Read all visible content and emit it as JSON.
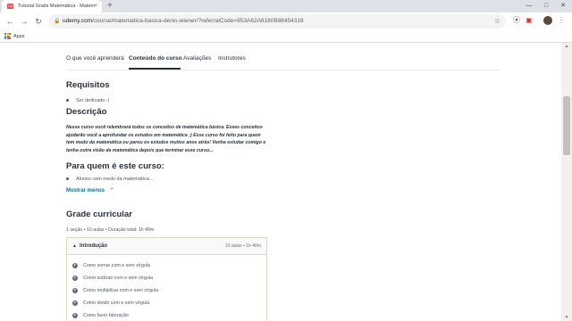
{
  "browser": {
    "tab_title": "Tutorial Gratis Matemática - Matem",
    "favicon_label": "Ud",
    "tab_close": "×",
    "new_tab": "+",
    "window_controls": [
      "—",
      "□",
      "✕"
    ],
    "back": "←",
    "forward": "→",
    "reload": "↻",
    "url_host": "udemy.com",
    "url_path": "/course/matematica-basica-denis-wiener/?referralCode=953A62A8180B88454316",
    "lock": "🔒",
    "star": "☆",
    "extensions": [
      "⦿",
      "◎",
      "⌘",
      "▣"
    ],
    "menu": "⋮",
    "bookmarks_apps": "Apps",
    "apps_colors": [
      "#ea4335",
      "#fbbc05",
      "#34a853",
      "#4285f4",
      "#ea4335",
      "#fbbc05",
      "#34a853",
      "#4285f4",
      "#ea4335"
    ]
  },
  "course_nav": {
    "tabs": [
      "O que você aprenderá",
      "Conteúdo do curso",
      "Avaliações",
      "Instrutores"
    ],
    "active_index": 1
  },
  "requirements": {
    "heading": "Requisitos",
    "items": [
      "Ser dedicado :)"
    ]
  },
  "description": {
    "heading": "Descrição",
    "lines": [
      "Nesse curso você relembrará todos os conceitos de matemática básica. Esses conceitos",
      "ajudarão você a aprofundar os estudos em matemática ;) Esse curso foi feito para quem",
      "tem medo da matemática ou parou os estudos muitos anos atrás! Venha estudar comigo e",
      "tenha outra visão da matemática depois que terminar esse curso..."
    ]
  },
  "audience": {
    "heading": "Para quem é este curso:",
    "items": [
      "Alunos com medo da matemática..."
    ],
    "show_less": "Mostrar menos",
    "show_less_icon": "⌃"
  },
  "curriculum": {
    "heading": "Grade curricular",
    "meta": "1 seção • 10 aulas • Duração total: 1h 40m",
    "section": {
      "caret": "▲",
      "title": "Introdução",
      "stats": "10 aulas • 1h 40m",
      "lectures": [
        "Como somar com e sem vírgula",
        "Como subtrair com e sem vírgula",
        "Como multiplicar com e sem vírgula",
        "Como dividir com e sem vírgula",
        "Como fazer fatoração"
      ]
    }
  },
  "scrollbar": {
    "up": "▲",
    "down": "▼"
  }
}
